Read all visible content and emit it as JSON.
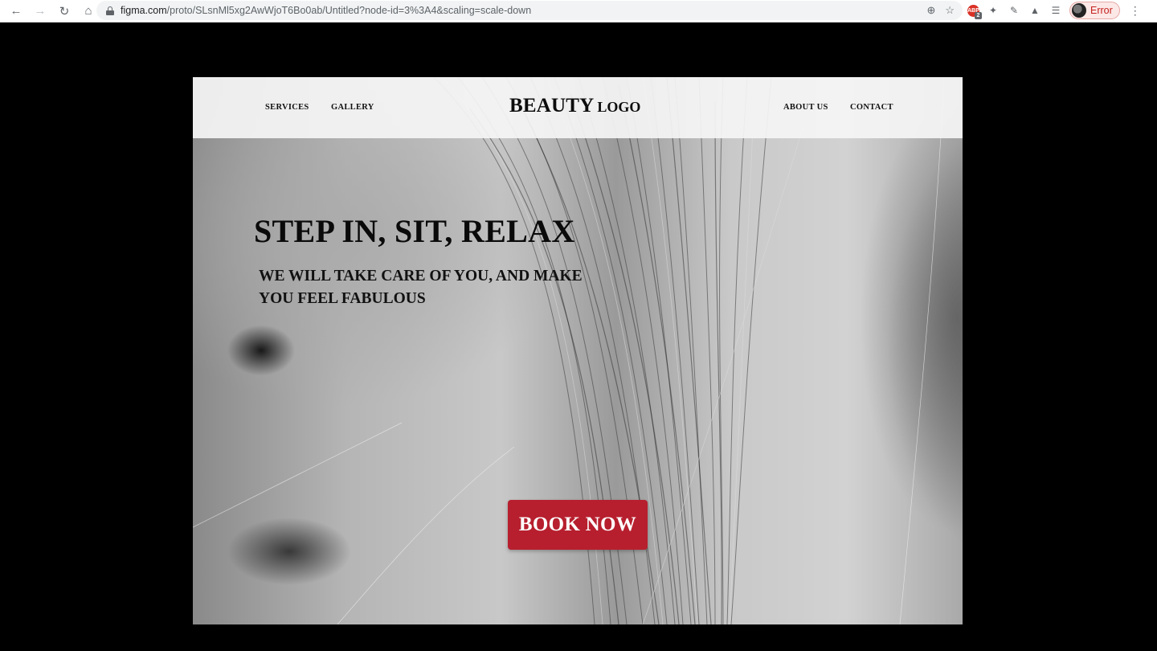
{
  "browser": {
    "url_host": "figma.com",
    "url_path": "/proto/SLsnMl5xg2AwWjoT6Bo0ab/Untitled?node-id=3%3A4&scaling=scale-down",
    "profile_status": "Error",
    "abp_label": "ABP",
    "abp_badge": "2",
    "icons": [
      "back-arrow",
      "forward-arrow",
      "reload",
      "home",
      "lock",
      "zoom",
      "star",
      "adblock",
      "extension",
      "puzzle",
      "media",
      "avatar",
      "menu"
    ]
  },
  "site": {
    "nav_left": [
      "SERVICES",
      "GALLERY"
    ],
    "nav_right": [
      "ABOUT US",
      "CONTACT"
    ],
    "logo_main": "BEAUTY",
    "logo_sub": "LOGO",
    "headline": "STEP IN, SIT, RELAX",
    "subline": "WE WILL TAKE CARE OF YOU, AND MAKE YOU FEEL FABULOUS",
    "cta_label": "BOOK NOW",
    "cta_color": "#b71f2e"
  }
}
